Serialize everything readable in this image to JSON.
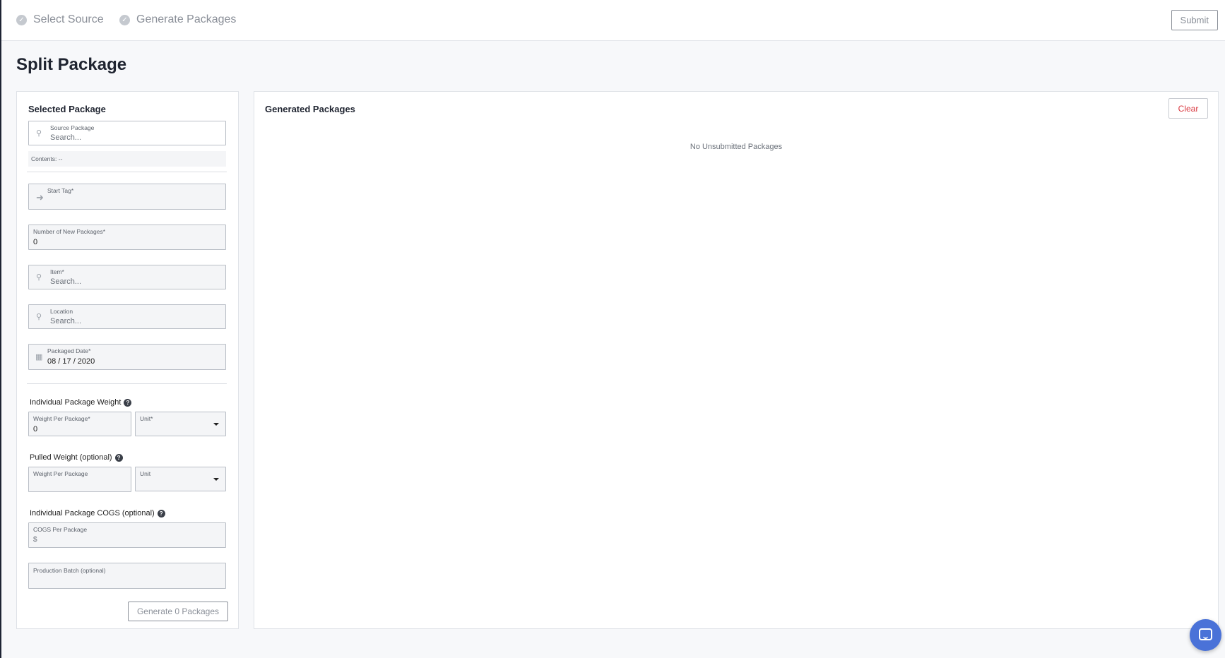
{
  "steps": [
    {
      "label": "Select Source"
    },
    {
      "label": "Generate Packages"
    }
  ],
  "header": {
    "submit_label": "Submit"
  },
  "page": {
    "title": "Split Package"
  },
  "left_panel": {
    "title": "Selected Package",
    "source_package": {
      "label": "Source Package",
      "placeholder": "Search..."
    },
    "contents_text": "Contents: --",
    "start_tag": {
      "label": "Start Tag*"
    },
    "num_packages": {
      "label": "Number of New Packages*",
      "value": "0"
    },
    "item": {
      "label": "Item*",
      "placeholder": "Search..."
    },
    "location": {
      "label": "Location",
      "placeholder": "Search..."
    },
    "packaged_date": {
      "label": "Packaged Date*",
      "value": "08 / 17 / 2020"
    },
    "individual_weight": {
      "section": "Individual Package Weight",
      "weight_label": "Weight Per Package*",
      "weight_value": "0",
      "unit_label": "Unit*"
    },
    "pulled_weight": {
      "section": "Pulled Weight (optional)",
      "weight_label": "Weight Per Package",
      "unit_label": "Unit"
    },
    "cogs": {
      "section": "Individual Package COGS (optional)",
      "label": "COGS Per Package",
      "prefix": "$"
    },
    "production_batch": {
      "label": "Production Batch (optional)"
    },
    "generate_label": "Generate 0 Packages"
  },
  "right_panel": {
    "title": "Generated Packages",
    "clear_label": "Clear",
    "empty_message": "No Unsubmitted Packages"
  },
  "icons": {
    "step_check": "check-circle-icon",
    "search": "search-icon",
    "arrow": "arrow-right-icon",
    "calendar": "calendar-icon",
    "help": "help-circle-icon",
    "chat": "chat-icon"
  },
  "colors": {
    "clear_text": "#d9363e",
    "chat_bubble": "#4a72d8",
    "sidebar_edge": "#1e2433"
  }
}
